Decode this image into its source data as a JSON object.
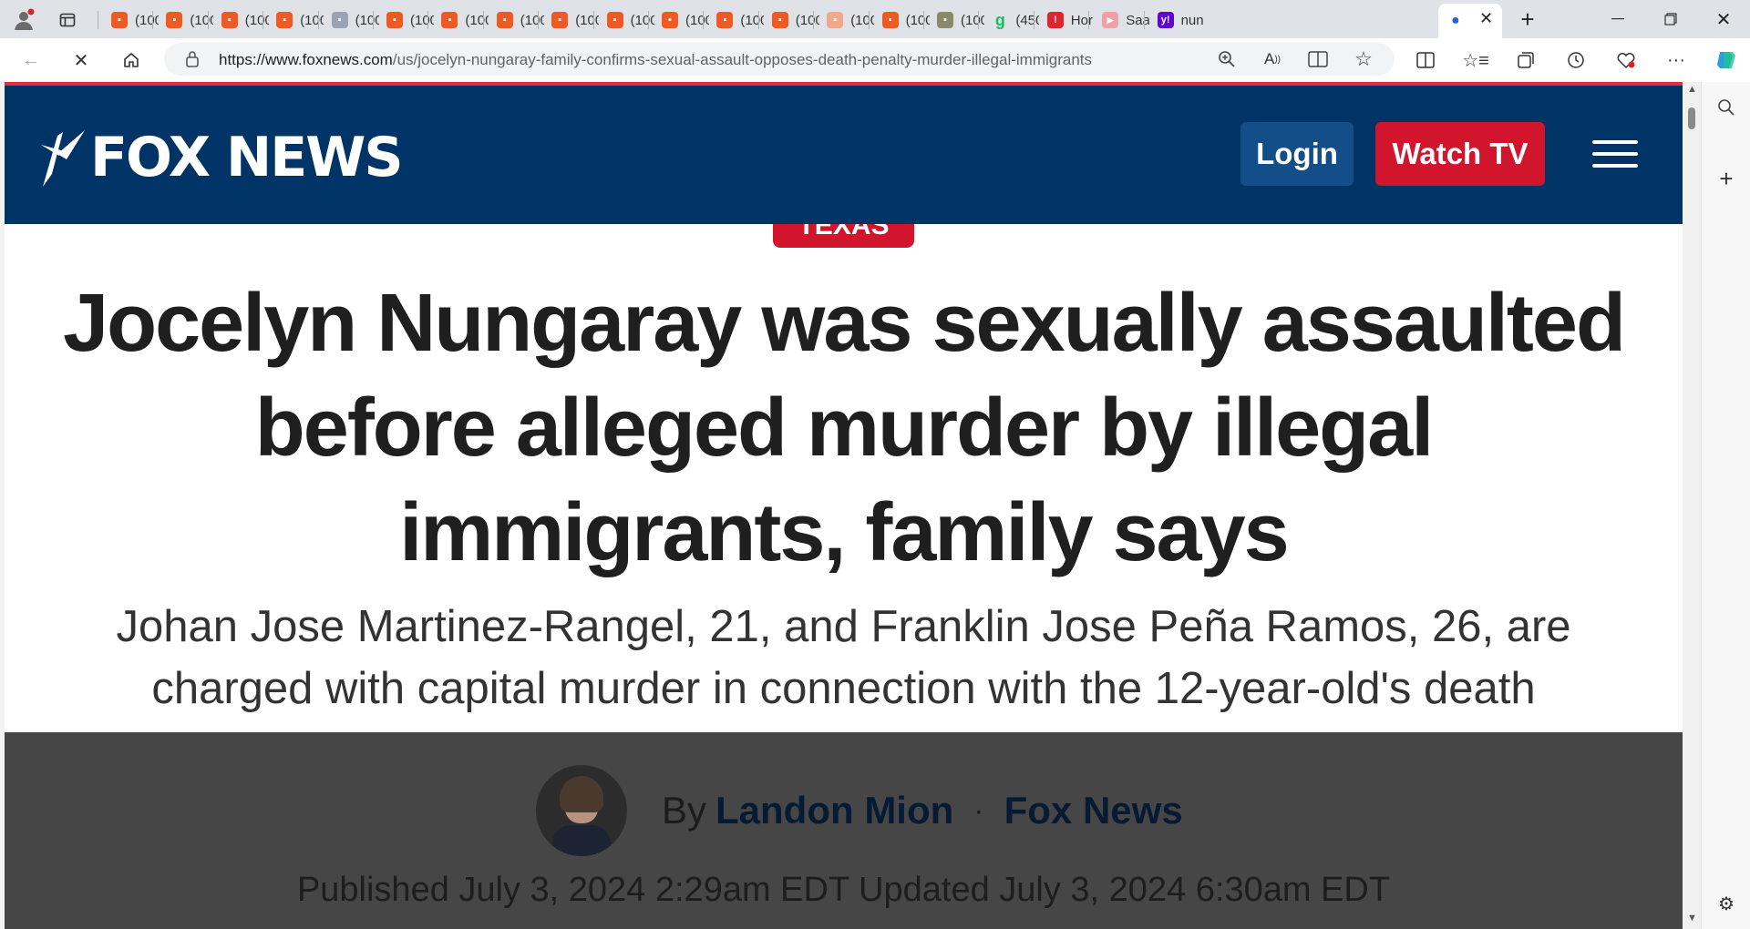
{
  "browser": {
    "tabs": [
      {
        "label": "(100",
        "icon": "bookmark-orange-icon",
        "color": "#f05a22"
      },
      {
        "label": "(100",
        "icon": "bookmark-orange-icon",
        "color": "#f05a22"
      },
      {
        "label": "(100",
        "icon": "bookmark-orange-icon",
        "color": "#f05a22"
      },
      {
        "label": "(100",
        "icon": "bookmark-orange-icon",
        "color": "#f05a22"
      },
      {
        "label": "(100",
        "icon": "image-thumbnail-icon",
        "color": "#9aa3b5"
      },
      {
        "label": "(100",
        "icon": "bookmark-orange-icon",
        "color": "#f05a22"
      },
      {
        "label": "(100",
        "icon": "bookmark-orange-icon",
        "color": "#f05a22"
      },
      {
        "label": "(100",
        "icon": "bookmark-orange-icon",
        "color": "#f05a22"
      },
      {
        "label": "(100",
        "icon": "bookmark-orange-icon",
        "color": "#f05a22"
      },
      {
        "label": "(100",
        "icon": "bookmark-orange-icon",
        "color": "#f05a22"
      },
      {
        "label": "(100",
        "icon": "bookmark-orange-icon",
        "color": "#f05a22"
      },
      {
        "label": "(100",
        "icon": "bookmark-orange-icon",
        "color": "#f05a22"
      },
      {
        "label": "(100",
        "icon": "bookmark-orange-icon",
        "color": "#f05a22"
      },
      {
        "label": "(100",
        "icon": "bookmark-light-icon",
        "color": "#f1a98a"
      },
      {
        "label": "(100",
        "icon": "bookmark-orange-icon",
        "color": "#f05a22"
      },
      {
        "label": "(100",
        "icon": "pattern-icon",
        "color": "#8a8a6a"
      },
      {
        "label": "(450",
        "icon": "g-letter-icon",
        "color": "#15c15d"
      },
      {
        "label": "Hor",
        "icon": "red-badge-icon",
        "color": "#e0242f"
      },
      {
        "label": "Saa",
        "icon": "youtube-icon",
        "color": "#f2a0a8"
      },
      {
        "label": "nun",
        "icon": "yahoo-icon",
        "color": "#6001d2"
      }
    ],
    "active_tab_icon": "loading-icon",
    "url_host": "https://www.foxnews.com",
    "url_path": "/us/jocelyn-nungaray-family-confirms-sexual-assault-opposes-death-penalty-murder-illegal-immigrants"
  },
  "site": {
    "logo_text": "FOX NEWS",
    "login_label": "Login",
    "watch_label": "Watch TV",
    "header_color": "#003366",
    "accent_red": "#d1152d"
  },
  "article": {
    "category": "TEXAS",
    "headline": "Jocelyn Nungaray was sexually assaulted before alleged murder by illegal immigrants, family says",
    "subheadline": "Johan Jose Martinez-Rangel, 21, and Franklin Jose Peña Ramos, 26, are charged with capital murder in connection with the 12-year-old's death",
    "by": "By",
    "author": "Landon Mion",
    "outlet": "Fox News",
    "published": "Published July 3, 2024 2:29am EDT Updated July 3, 2024 6:30am EDT"
  }
}
